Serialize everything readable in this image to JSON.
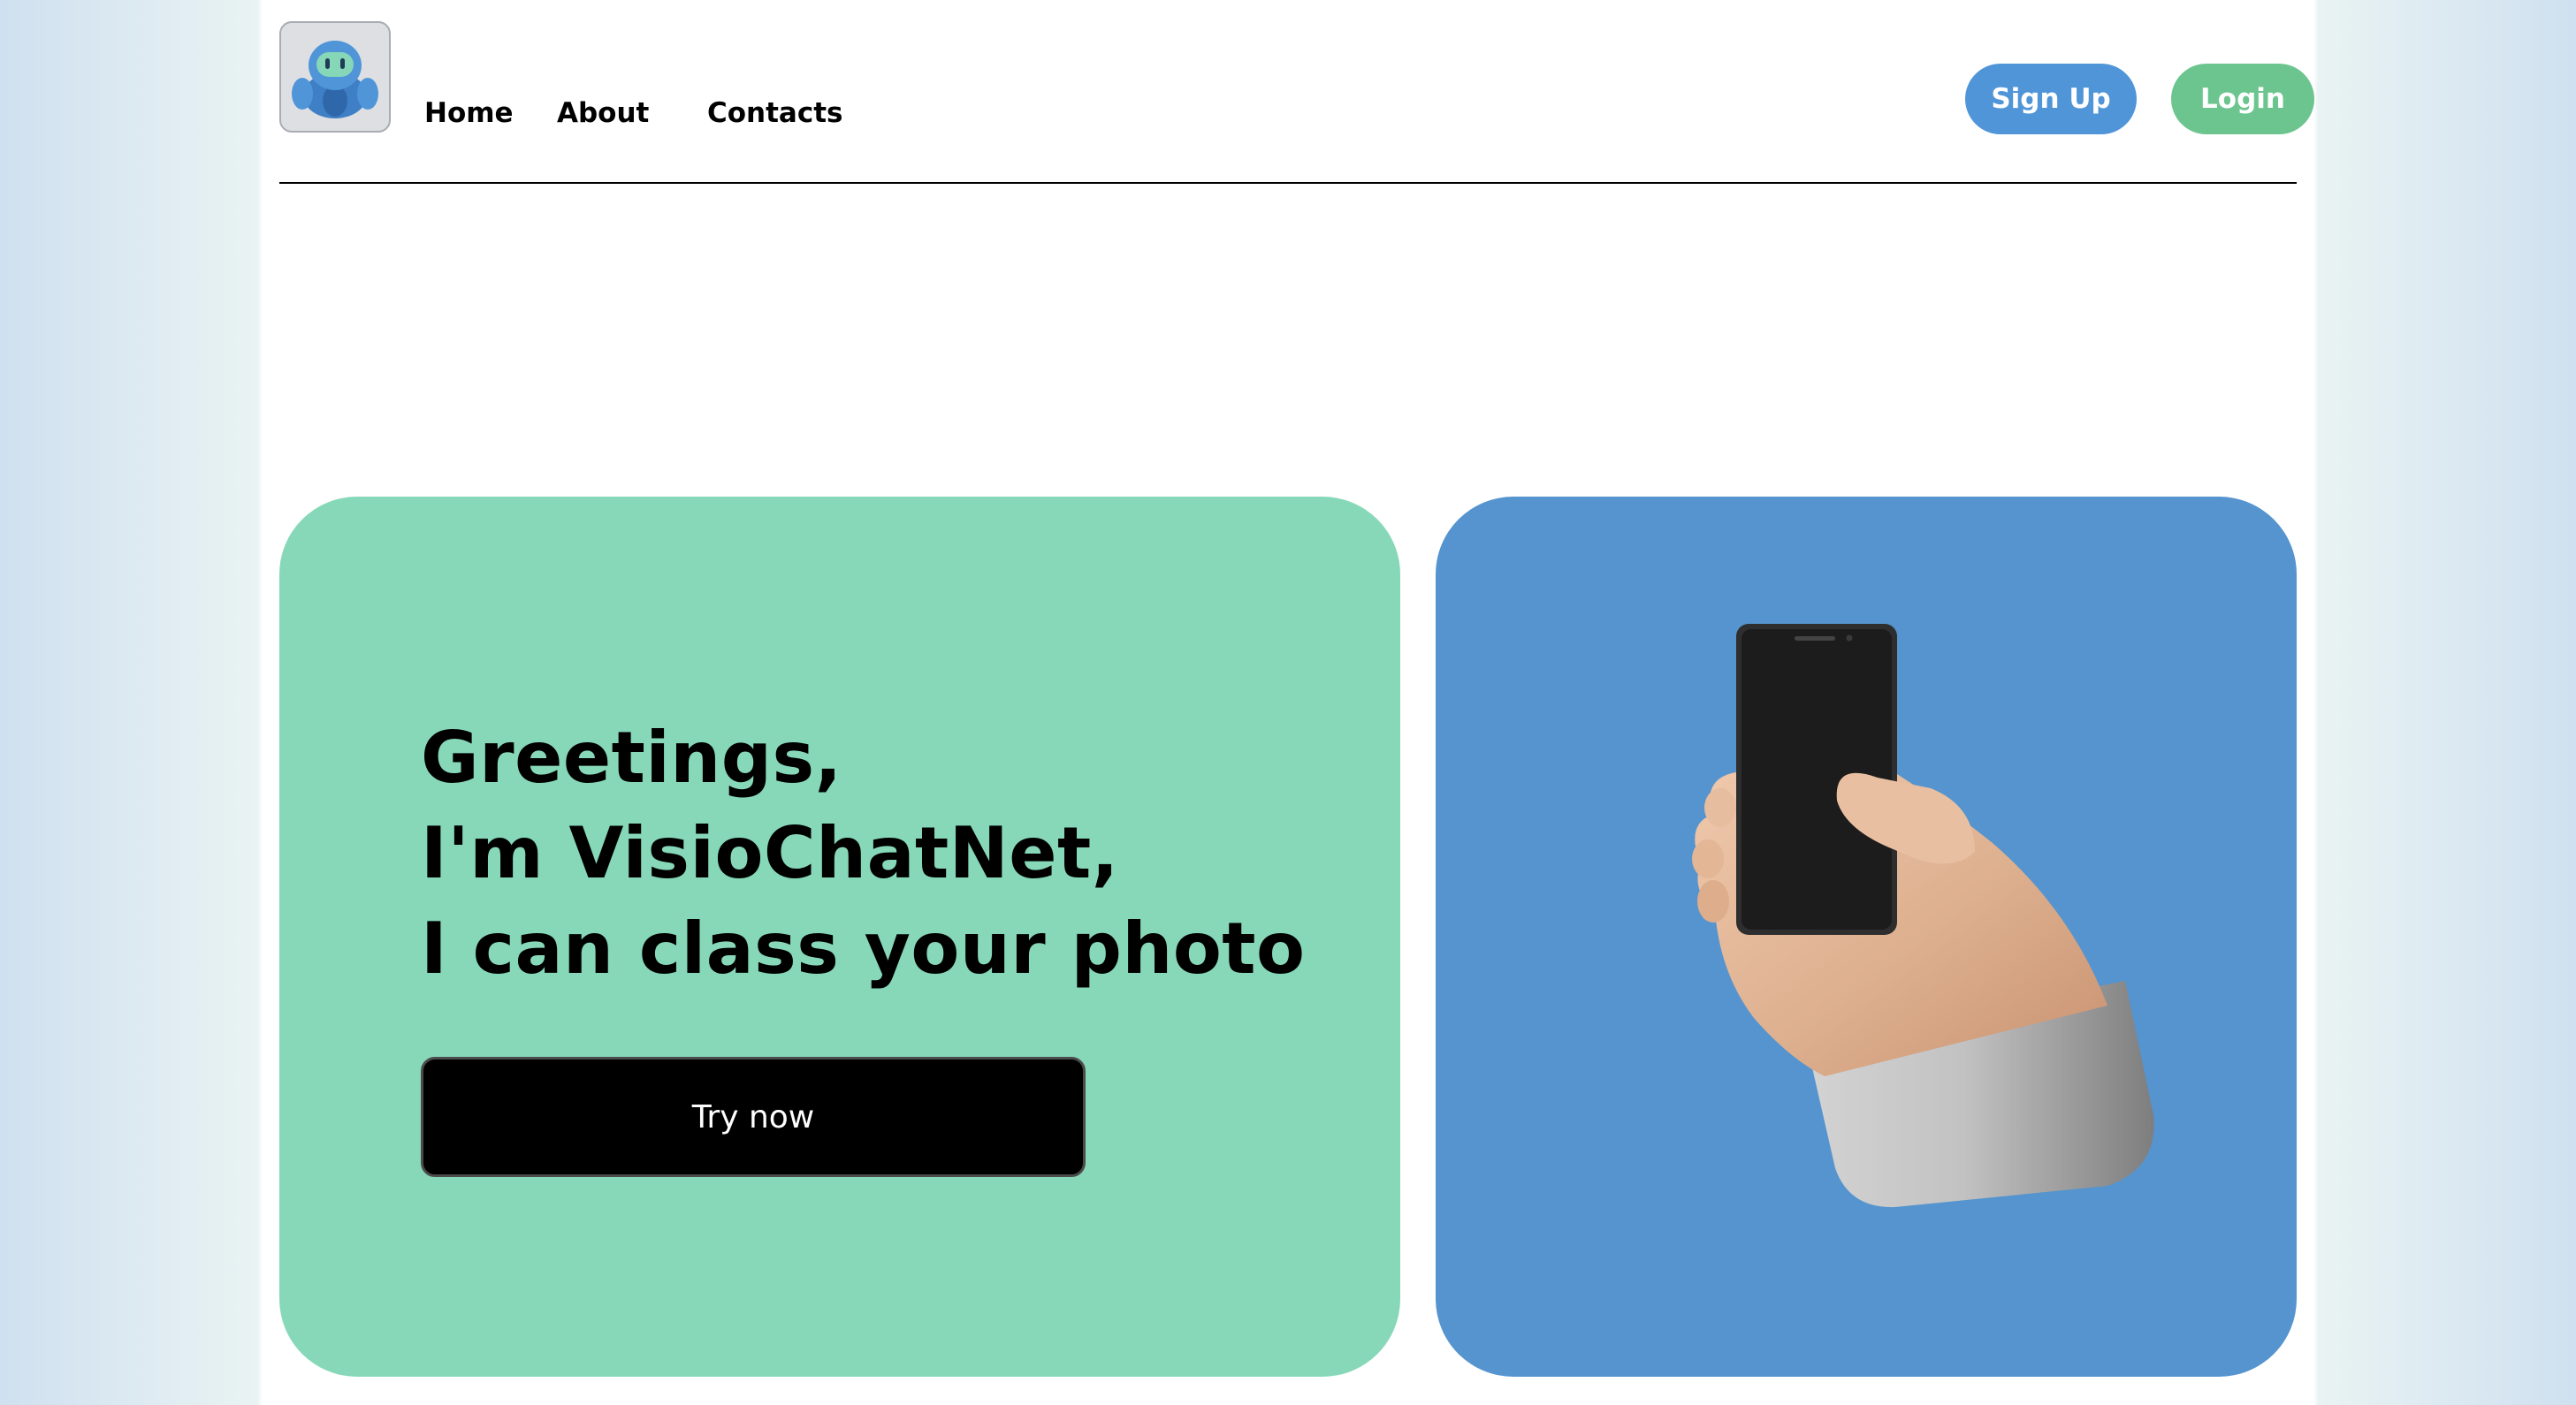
{
  "nav": {
    "items": [
      {
        "label": "Home"
      },
      {
        "label": "About"
      },
      {
        "label": "Contacts"
      }
    ]
  },
  "auth": {
    "signup_label": "Sign Up",
    "login_label": "Login"
  },
  "hero": {
    "lines": [
      "Greetings,",
      "I'm VisioChatNet,",
      "I can class your photo"
    ],
    "cta_label": "Try now"
  },
  "icons": {
    "logo": "robot-mascot-icon",
    "illustration": "hand-holding-phone-illustration"
  },
  "colors": {
    "signup": "#4f95d8",
    "login": "#6cc58f",
    "hero_left_card": "#87d8b9",
    "hero_right_card": "#5594ce",
    "cta": "#000000"
  }
}
